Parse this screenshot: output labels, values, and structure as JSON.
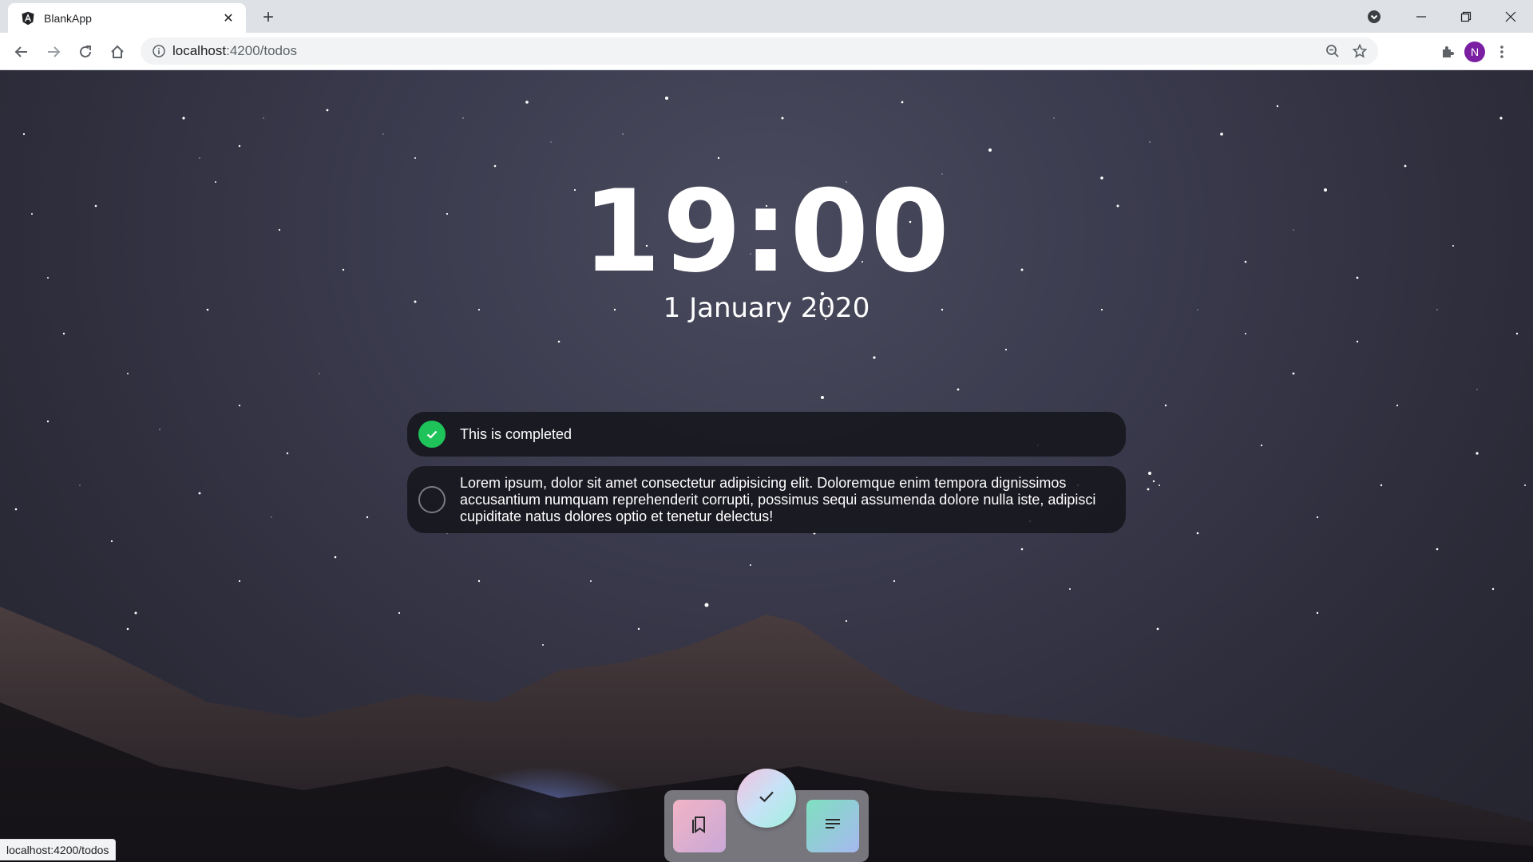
{
  "tab": {
    "title": "BlankApp",
    "favicon": "angular-icon"
  },
  "toolbar": {
    "url_host": "localhost",
    "url_rest": ":4200/todos",
    "profile_initial": "N"
  },
  "page": {
    "time": "19:00",
    "date": "1 January 2020",
    "todos": [
      {
        "text": "This is completed",
        "completed": true
      },
      {
        "text": "Lorem ipsum, dolor sit amet consectetur adipisicing elit. Doloremque enim tempora dignissimos accusantium numquam reprehenderit corrupti, possimus sequi assumenda dolore nulla iste, adipisci cupiditate natus dolores optio et tenetur delectus!",
        "completed": false
      }
    ],
    "dock": {
      "left_icon": "bookmarks-icon",
      "center_icon": "check-icon",
      "right_icon": "notes-icon"
    }
  },
  "status": {
    "hover_url": "localhost:4200/todos"
  },
  "colors": {
    "completed_check": "#1ec35a",
    "profile": "#7b1fa2"
  }
}
